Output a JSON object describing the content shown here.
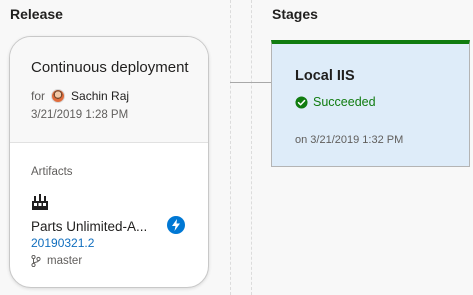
{
  "release": {
    "section_title": "Release",
    "trigger": {
      "name": "Continuous deployment",
      "for_label": "for",
      "user": "Sachin Raj",
      "date": "3/21/2019 1:28 PM"
    },
    "artifacts": {
      "label": "Artifacts",
      "icon": "build-pipeline-icon",
      "name": "Parts Unlimited-A...",
      "version": "20190321.2",
      "branch": "master",
      "trigger_icon": "lightning-icon"
    }
  },
  "stages": {
    "section_title": "Stages",
    "items": [
      {
        "name": "Local IIS",
        "status": "Succeeded",
        "status_icon": "check-circle-icon",
        "date": "on 3/21/2019 1:32 PM"
      }
    ]
  },
  "colors": {
    "success": "#107c10",
    "stage_bg": "#deecf9",
    "link": "#106ebe",
    "accent": "#0078d4"
  }
}
